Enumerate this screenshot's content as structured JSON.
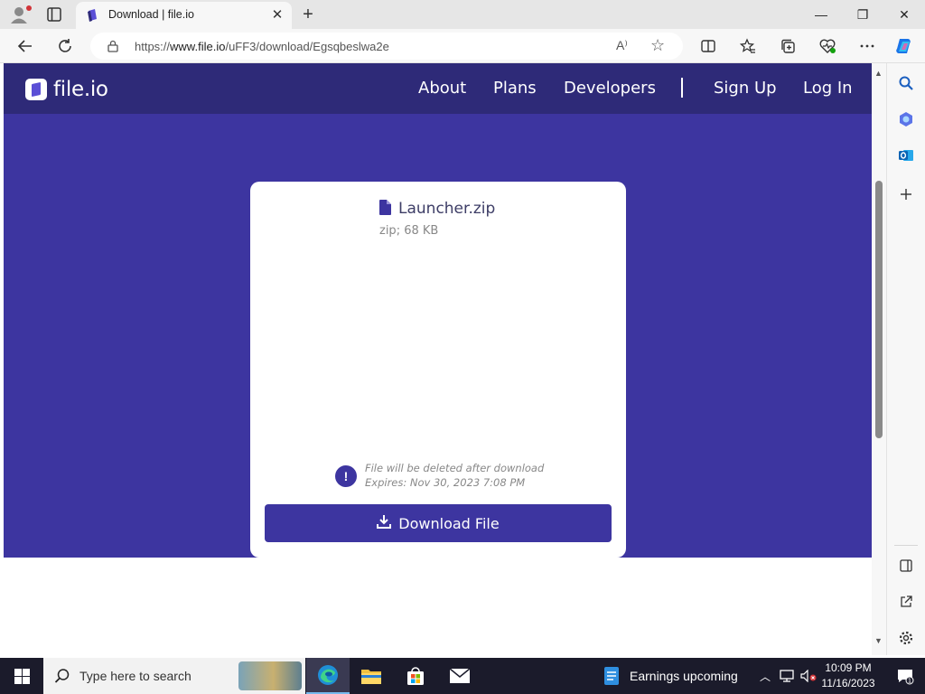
{
  "browser": {
    "tab_title": "Download | file.io",
    "new_tab_symbol": "+",
    "tab_close_symbol": "✕",
    "window_controls": {
      "minimize": "—",
      "restore": "❐",
      "close": "✕"
    },
    "url_prefix": "https://",
    "url_domain": "www.file.io",
    "url_path": "/uFF3/download/Egsqbeslwa2e",
    "read_aloud_symbol": "A⁾",
    "favorite_symbol": "☆"
  },
  "site": {
    "logo_text": "file.io",
    "nav": {
      "about": "About",
      "plans": "Plans",
      "developers": "Developers",
      "signup": "Sign Up",
      "login": "Log In"
    },
    "brand_color": "#3d35a0",
    "header_color": "#2e2a78"
  },
  "file": {
    "name": "Launcher.zip",
    "meta": "zip; 68 KB",
    "notice_line1": "File will be deleted after download",
    "notice_line2": "Expires: Nov 30, 2023 7:08 PM",
    "notice_symbol": "!",
    "download_label": "Download File"
  },
  "scrollbar": {
    "up_symbol": "▲",
    "down_symbol": "▼"
  },
  "taskbar": {
    "search_placeholder": "Type here to search",
    "weather_text": "Earnings upcoming",
    "time": "10:09 PM",
    "date": "11/16/2023",
    "tray_chevron": "︿",
    "notification_count": "1"
  },
  "icons": [
    "profile-icon",
    "tab-actions-icon",
    "back-icon",
    "refresh-icon",
    "lock-icon",
    "split-screen-icon",
    "favorites-icon",
    "collections-icon",
    "browser-essentials-icon",
    "more-icon",
    "copilot-icon",
    "search-icon",
    "copilot-side-icon",
    "outlook-icon",
    "add-icon",
    "sidebar-toggle-icon",
    "external-link-icon",
    "settings-icon",
    "windows-start-icon",
    "edge-icon",
    "file-explorer-icon",
    "store-icon",
    "mail-icon",
    "network-icon",
    "volume-muted-icon",
    "notification-icon"
  ]
}
